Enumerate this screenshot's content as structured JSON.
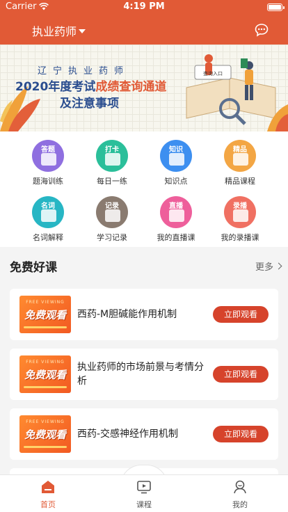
{
  "status_bar": {
    "carrier": "Carrier",
    "time": "4:19 PM"
  },
  "nav": {
    "title": "执业药师",
    "chat_icon": "chat-bubble-icon"
  },
  "banner": {
    "line1": "辽宁执业药师",
    "line2_prefix": "2020年度考试",
    "line2_highlight": "成绩查询通道",
    "line3": "及注意事项",
    "board_text": "查询入口"
  },
  "grid": [
    {
      "tag": "答题",
      "label": "题海训练",
      "color": "#8f6fe0"
    },
    {
      "tag": "打卡",
      "label": "每日一练",
      "color": "#2bbf9a"
    },
    {
      "tag": "知识",
      "label": "知识点",
      "color": "#3d8ff0"
    },
    {
      "tag": "精品",
      "label": "精品课程",
      "color": "#f3a644"
    },
    {
      "tag": "名词",
      "label": "名词解释",
      "color": "#27b6c4"
    },
    {
      "tag": "记录",
      "label": "学习记录",
      "color": "#8a7b70"
    },
    {
      "tag": "直播",
      "label": "我的直播课",
      "color": "#ee5f9b"
    },
    {
      "tag": "录播",
      "label": "我的录播课",
      "color": "#f07062"
    }
  ],
  "section": {
    "title": "免费好课",
    "more": "更多"
  },
  "courses": [
    {
      "title": "西药-M胆碱能作用机制",
      "button": "立即观看",
      "thumb_top": "FREE VIEWING",
      "thumb_main": "免费观看"
    },
    {
      "title": "执业药师的市场前景与考情分析",
      "button": "立即观看",
      "thumb_top": "FREE VIEWING",
      "thumb_main": "免费观看"
    },
    {
      "title": "西药-交感神经作用机制",
      "button": "立即观看",
      "thumb_top": "FREE VIEWING",
      "thumb_main": "免费观看"
    }
  ],
  "tabs": [
    {
      "label": "首页",
      "icon": "home-icon",
      "active": true
    },
    {
      "label": "课程",
      "icon": "course-icon",
      "active": false
    },
    {
      "label": "我的",
      "icon": "profile-icon",
      "active": false
    }
  ],
  "colors": {
    "brand": "#e15a36",
    "button": "#d6432b"
  }
}
